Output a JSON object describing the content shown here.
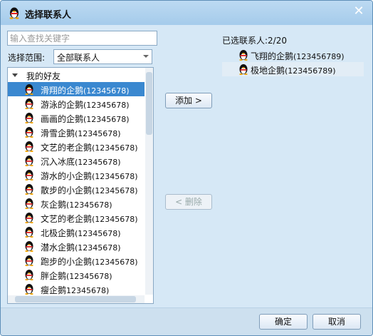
{
  "window": {
    "title": "选择联系人",
    "title_icon": "penguin-icon",
    "close_icon": "close-icon"
  },
  "search": {
    "placeholder": "输入查找关键字",
    "value": ""
  },
  "range": {
    "label": "选择范围:",
    "selected": "全部联系人"
  },
  "tree": {
    "group_label": "我的好友",
    "items": [
      {
        "name": "滑翔的企鹅",
        "num": "(12345678)",
        "selected": true
      },
      {
        "name": "游泳的企鹅",
        "num": "(12345678)"
      },
      {
        "name": "画画的企鹅",
        "num": "(12345678)"
      },
      {
        "name": "滑雪企鹅",
        "num": "(12345678)"
      },
      {
        "name": "文艺的老企鹅",
        "num": "(12345678)"
      },
      {
        "name": "沉入冰底",
        "num": "(12345678)"
      },
      {
        "name": "游水的小企鹅",
        "num": "(12345678)"
      },
      {
        "name": "散步的小企鹅",
        "num": "(12345678)"
      },
      {
        "name": "灰企鹅",
        "num": "(12345678)"
      },
      {
        "name": "文艺的老企鹅",
        "num": "(12345678)"
      },
      {
        "name": "北极企鹅",
        "num": "(12345678)"
      },
      {
        "name": "潜水企鹅",
        "num": "(12345678)"
      },
      {
        "name": "跑步的小企鹅",
        "num": "(12345678)"
      },
      {
        "name": "胖企鹅",
        "num": "(12345678)"
      },
      {
        "name": "瘦企鹅",
        "num": "12345678)"
      }
    ]
  },
  "buttons": {
    "add": "添加 >",
    "delete": "< 删除",
    "ok": "确定",
    "cancel": "取消"
  },
  "selected_panel": {
    "label": "已选联系人:2/20",
    "items": [
      {
        "name": "飞翔的企鹅",
        "num": "(123456789)"
      },
      {
        "name": "极地企鹅",
        "num": "(123456789)"
      }
    ]
  },
  "colors": {
    "title_bar": "#a5cbeb",
    "selection": "#3a88d0",
    "dialog_bg": "#d6e8f6"
  }
}
